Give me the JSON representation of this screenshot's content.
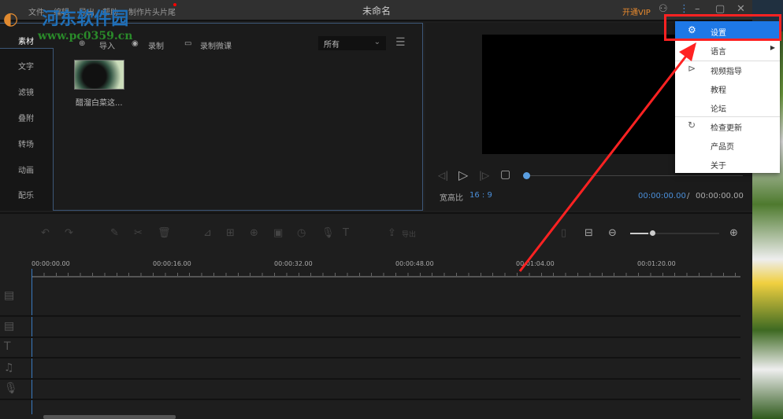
{
  "titlebar": {
    "menus": [
      "文件",
      "编辑",
      "导出",
      "帮助",
      "制作片头片尾"
    ],
    "title": "未命名",
    "vip": "开通VIP"
  },
  "library": {
    "toolbar": {
      "import": "导入",
      "record": "录制",
      "record_course": "录制微课"
    },
    "filter": "所有",
    "clip_name": "醋溜白菜这...",
    "sidebar": [
      "素材",
      "文字",
      "滤镜",
      "叠附",
      "转场",
      "动画",
      "配乐"
    ]
  },
  "preview": {
    "aspect_label": "宽高比",
    "aspect_value": "16 : 9",
    "current_time": "00:00:00.00",
    "separator": "/",
    "total_time": "00:00:00.00"
  },
  "timeline": {
    "export": "导出",
    "ruler": [
      "00:00:00.00",
      "00:00:16.00",
      "00:00:32.00",
      "00:00:48.00",
      "00:01:04.00",
      "00:01:20.00"
    ],
    "zoom": 0.2
  },
  "dropdown": {
    "items": [
      "设置",
      "语言",
      "视频指导",
      "教程",
      "论坛",
      "检查更新",
      "产品页",
      "关于"
    ]
  },
  "watermark": {
    "name": "河东软件园",
    "url": "www.pc0359.cn"
  },
  "colors": {
    "accent": "#1e78e6",
    "highlight": "#ff2222",
    "vip": "#e88a2e"
  }
}
